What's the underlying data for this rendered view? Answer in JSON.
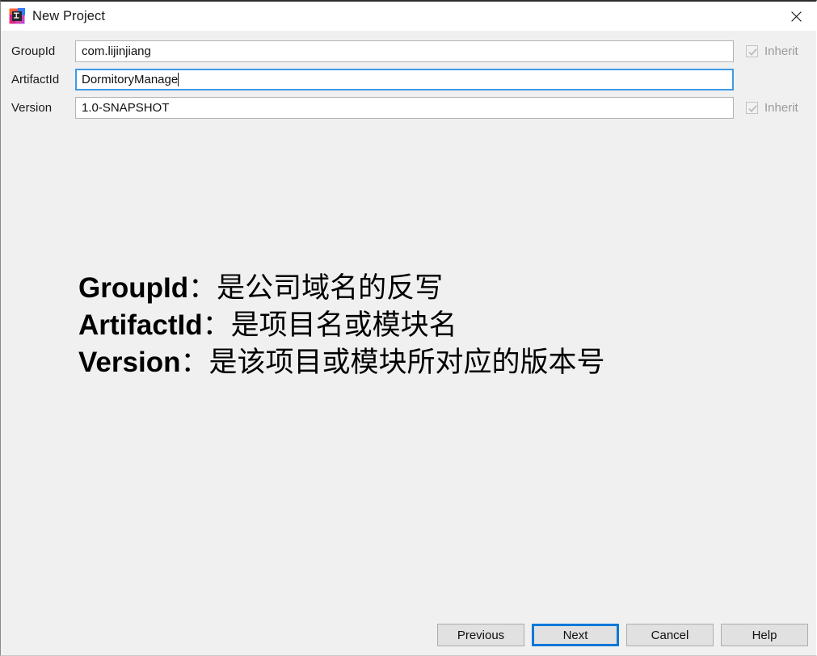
{
  "window": {
    "title": "New Project",
    "app_icon": "intellij-idea-icon",
    "close_icon": "close-icon"
  },
  "form": {
    "rows": [
      {
        "label": "GroupId",
        "value": "com.lijinjiang",
        "focused": false,
        "inherit": {
          "label": "Inherit",
          "checked": true,
          "enabled": false,
          "icon": "check-icon"
        }
      },
      {
        "label": "ArtifactId",
        "value": "DormitoryManage",
        "focused": true,
        "inherit": null
      },
      {
        "label": "Version",
        "value": "1.0-SNAPSHOT",
        "focused": false,
        "inherit": {
          "label": "Inherit",
          "checked": true,
          "enabled": false,
          "icon": "check-icon"
        }
      }
    ]
  },
  "annotation": {
    "lines": [
      {
        "key": "GroupId",
        "value": "：是公司域名的反写"
      },
      {
        "key": "ArtifactId",
        "value": "：是项目名或模块名"
      },
      {
        "key": "Version",
        "value": "：是该项目或模块所对应的版本号"
      }
    ]
  },
  "footer": {
    "buttons": [
      {
        "label": "Previous",
        "default": false
      },
      {
        "label": "Next",
        "default": true
      },
      {
        "label": "Cancel",
        "default": false
      },
      {
        "label": "Help",
        "default": false
      }
    ]
  },
  "colors": {
    "accent": "#0078d7",
    "focus_border": "#3d9ae8",
    "dialog_bg": "#f0f0f0",
    "button_bg": "#e1e1e1",
    "disabled_text": "#9a9a9a"
  }
}
